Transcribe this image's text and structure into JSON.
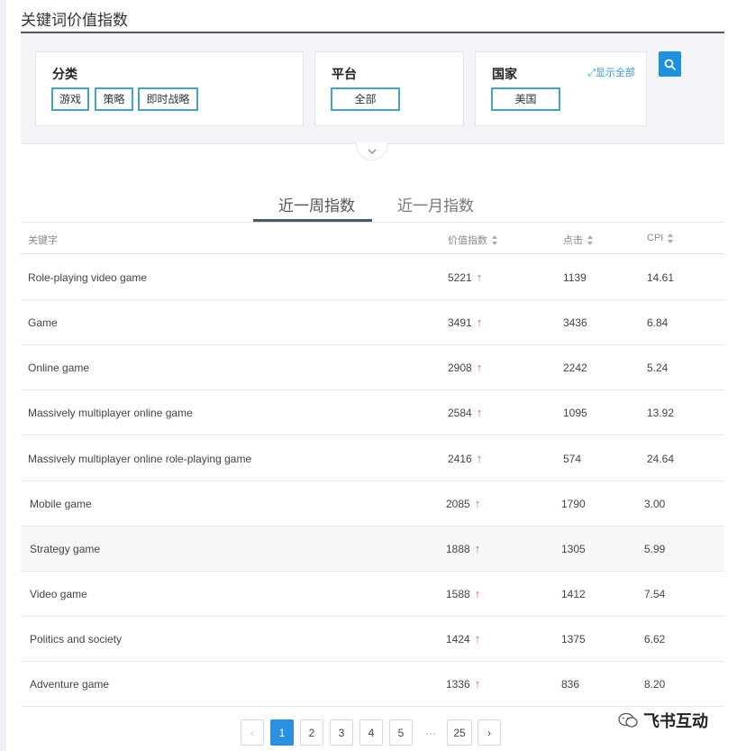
{
  "page": {
    "title": "关键词价值指数"
  },
  "filters": {
    "category": {
      "title": "分类",
      "tags": [
        "游戏",
        "策略",
        "即时战略"
      ]
    },
    "platform": {
      "title": "平台",
      "tags": [
        "全部"
      ]
    },
    "country": {
      "title": "国家",
      "show_all": "显示全部",
      "tags": [
        "美国"
      ]
    }
  },
  "tabs": [
    {
      "label": "近一周指数",
      "active": true
    },
    {
      "label": "近一月指数",
      "active": false
    }
  ],
  "table": {
    "headers": [
      "关键字",
      "价值指数",
      "点击",
      "CPI"
    ],
    "rows": [
      {
        "keyword": "Role-playing video game",
        "index": "5221",
        "clicks": "1139",
        "cpi": "14.61"
      },
      {
        "keyword": "Game",
        "index": "3491",
        "clicks": "3436",
        "cpi": "6.84"
      },
      {
        "keyword": "Online game",
        "index": "2908",
        "clicks": "2242",
        "cpi": "5.24"
      },
      {
        "keyword": "Massively multiplayer online game",
        "index": "2584",
        "clicks": "1095",
        "cpi": "13.92"
      },
      {
        "keyword": "Massively multiplayer online role-playing game",
        "index": "2416",
        "clicks": "574",
        "cpi": "24.64"
      },
      {
        "keyword": "Mobile game",
        "index": "2085",
        "clicks": "1790",
        "cpi": "3.00"
      },
      {
        "keyword": "Strategy game",
        "index": "1888",
        "clicks": "1305",
        "cpi": "5.99"
      },
      {
        "keyword": "Video game",
        "index": "1588",
        "clicks": "1412",
        "cpi": "7.54"
      },
      {
        "keyword": "Politics and society",
        "index": "1424",
        "clicks": "1375",
        "cpi": "6.62"
      },
      {
        "keyword": "Adventure game",
        "index": "1336",
        "clicks": "836",
        "cpi": "8.20"
      }
    ],
    "trend_icon": "arrow-up-icon",
    "trend_color": "#e55a5a"
  },
  "pagination": {
    "prev": "‹",
    "next": "›",
    "pages": [
      "1",
      "2",
      "3",
      "4",
      "5"
    ],
    "ellipsis": "···",
    "last": "25",
    "current": "1"
  },
  "watermark": {
    "text": "飞书互动"
  },
  "colors": {
    "accent": "#2d8fe0",
    "tag_border": "#45a3c6",
    "search_button": "#1f8fe0"
  }
}
